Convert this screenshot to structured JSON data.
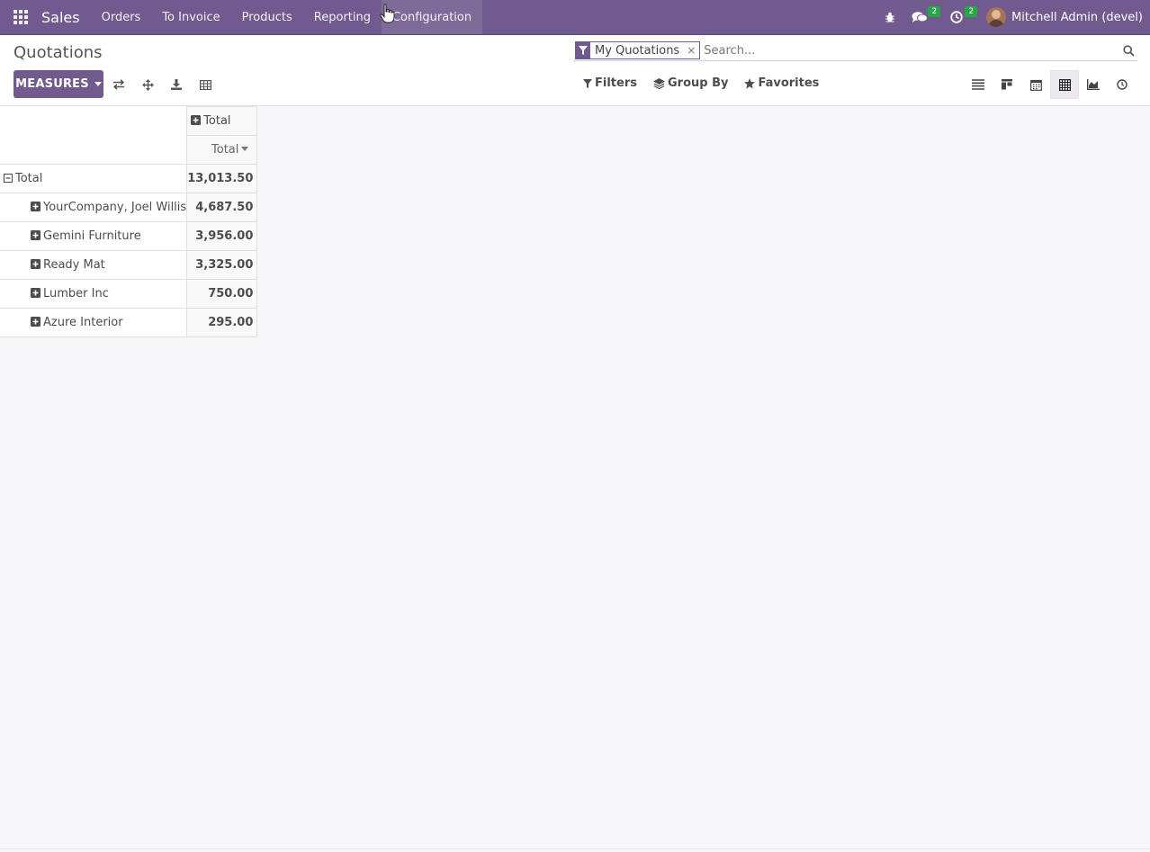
{
  "navbar": {
    "app_name": "Sales",
    "menu": [
      {
        "label": "Orders"
      },
      {
        "label": "To Invoice"
      },
      {
        "label": "Products"
      },
      {
        "label": "Reporting"
      },
      {
        "label": "Configuration"
      }
    ],
    "messages_count": "2",
    "activities_count": "2",
    "user_name": "Mitchell Admin (devel)"
  },
  "control_panel": {
    "breadcrumb": "Quotations",
    "measures_label": "MEASURES",
    "search": {
      "facet_value": "My Quotations",
      "facet_remove": "×",
      "placeholder": "Search..."
    },
    "filters_label": "Filters",
    "group_by_label": "Group By",
    "favorites_label": "Favorites",
    "active_view": "pivot"
  },
  "pivot": {
    "col_header": "Total",
    "measure_header": "Total",
    "total_row": {
      "label": "Total",
      "value": "13,013.50"
    },
    "rows": [
      {
        "label": "YourCompany, Joel Willis",
        "value": "4,687.50"
      },
      {
        "label": "Gemini Furniture",
        "value": "3,956.00"
      },
      {
        "label": "Ready Mat",
        "value": "3,325.00"
      },
      {
        "label": "Lumber Inc",
        "value": "750.00"
      },
      {
        "label": "Azure Interior",
        "value": "295.00"
      }
    ]
  },
  "colors": {
    "brand": "#715b8e",
    "badge": "#28a745"
  }
}
